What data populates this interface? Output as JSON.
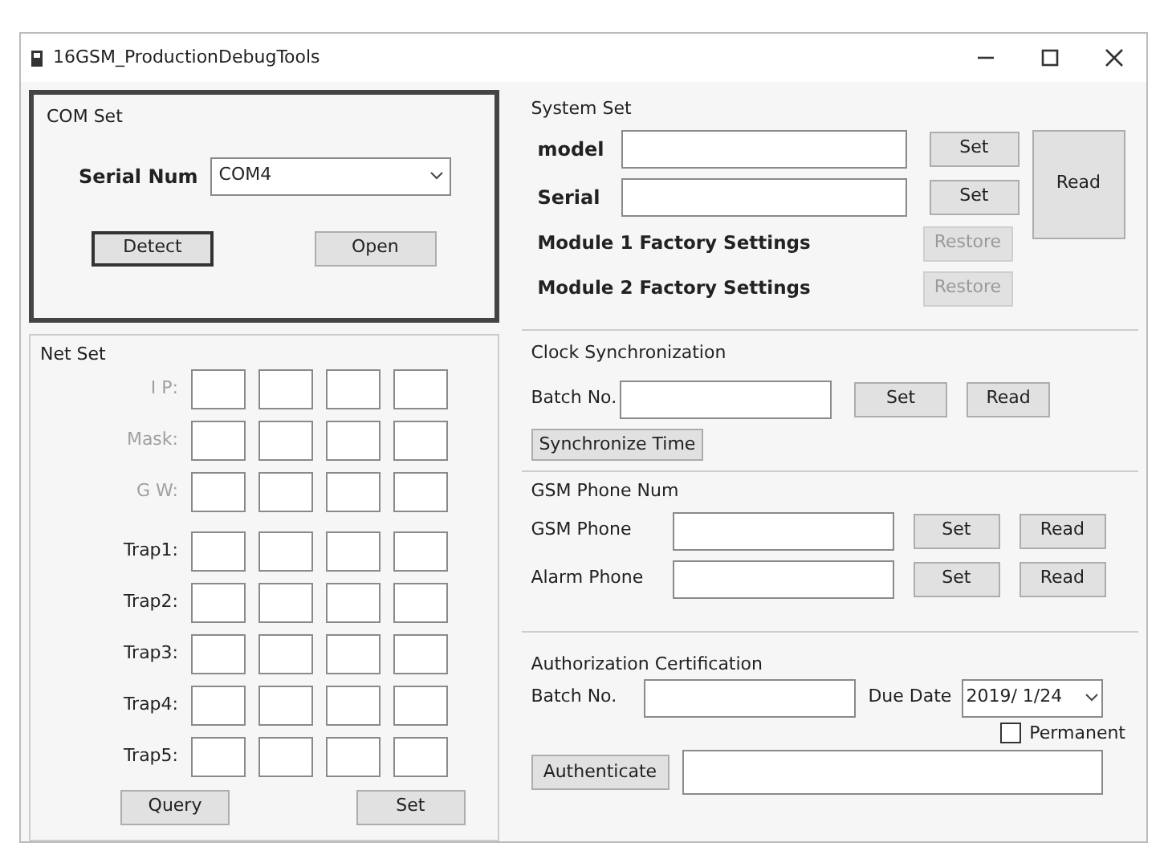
{
  "window": {
    "title": "16GSM_ProductionDebugTools"
  },
  "com_set": {
    "title": "COM Set",
    "serial_label": "Serial Num",
    "serial_value": "COM4",
    "buttons": [
      {
        "label": "Detect",
        "focused": true
      },
      {
        "label": "Open",
        "focused": false
      }
    ]
  },
  "system_set": {
    "title": "System Set",
    "fields": [
      {
        "label": "model",
        "button": "Set"
      },
      {
        "label": "Serial",
        "button": "Set"
      }
    ],
    "read_button": "Read",
    "factory": [
      {
        "label": "Module 1 Factory Settings",
        "button": "Restore",
        "disabled": true
      },
      {
        "label": "Module 2 Factory Settings",
        "button": "Restore",
        "disabled": true
      }
    ]
  },
  "net_set": {
    "title": "Net Set",
    "rows": [
      {
        "label": "I P:",
        "disabled": true
      },
      {
        "label": "Mask:",
        "disabled": true
      },
      {
        "label": "G W:",
        "disabled": true
      },
      {
        "label": "Trap1:",
        "disabled": false
      },
      {
        "label": "Trap2:",
        "disabled": false
      },
      {
        "label": "Trap3:",
        "disabled": false
      },
      {
        "label": "Trap4:",
        "disabled": false
      },
      {
        "label": "Trap5:",
        "disabled": false
      }
    ],
    "buttons": [
      "Query",
      "Set"
    ]
  },
  "clock": {
    "title": "Clock Synchronization",
    "batch_label": "Batch No.",
    "buttons": [
      "Set",
      "Read"
    ],
    "sync_button": "Synchronize Time"
  },
  "gsm": {
    "title": "GSM Phone Num",
    "rows": [
      {
        "label": "GSM Phone",
        "buttons": [
          "Set",
          "Read"
        ]
      },
      {
        "label": "Alarm Phone",
        "buttons": [
          "Set",
          "Read"
        ]
      }
    ]
  },
  "auth": {
    "title": "Authorization Certification",
    "batch_label": "Batch No.",
    "due_label": "Due Date",
    "due_value": "2019/ 1/24",
    "permanent": {
      "label": "Permanent",
      "checked": false
    },
    "button": "Authenticate"
  }
}
